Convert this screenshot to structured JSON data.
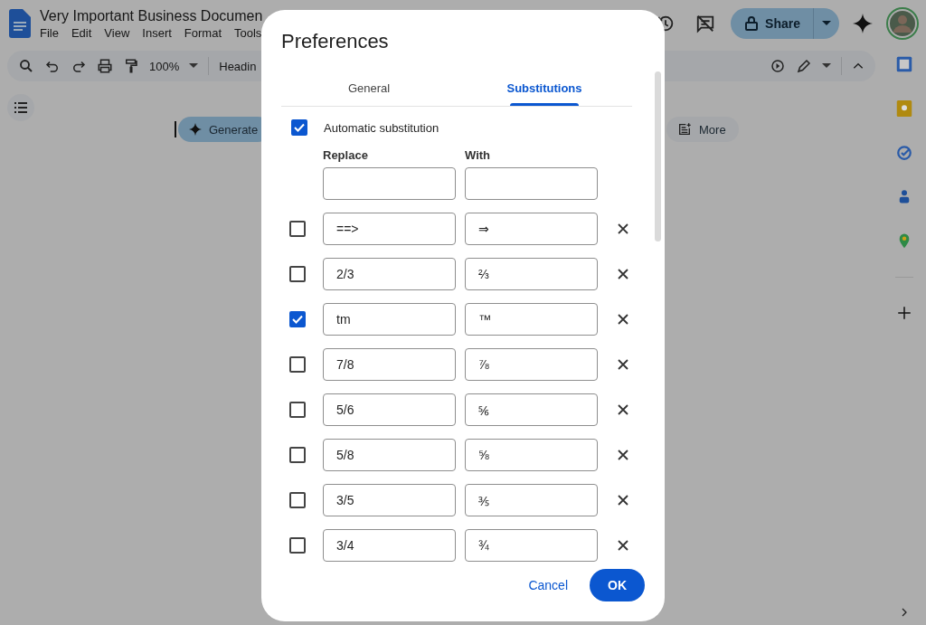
{
  "document": {
    "title": "Very Important Business Documen",
    "menu": [
      "File",
      "Edit",
      "View",
      "Insert",
      "Format",
      "Tools"
    ],
    "zoom": "100%",
    "style": "Headin",
    "share": "Share",
    "chips": [
      {
        "kind": "generate",
        "label": "Generate"
      },
      {
        "kind": "more",
        "label": "More"
      }
    ]
  },
  "dialog": {
    "title": "Preferences",
    "tabs": [
      {
        "label": "General",
        "selected": false
      },
      {
        "label": "Substitutions",
        "selected": true
      }
    ],
    "automatic": {
      "label": "Automatic substitution",
      "checked": true
    },
    "columns": [
      "Replace",
      "With"
    ],
    "rows": [
      {
        "replace": "==>",
        "with": "⇒",
        "checked": false
      },
      {
        "replace": "2/3",
        "with": "⅔",
        "checked": false
      },
      {
        "replace": "tm",
        "with": "™",
        "checked": true
      },
      {
        "replace": "7/8",
        "with": "⅞",
        "checked": false
      },
      {
        "replace": "5/6",
        "with": "⅚",
        "checked": false
      },
      {
        "replace": "5/8",
        "with": "⅝",
        "checked": false
      },
      {
        "replace": "3/5",
        "with": "⅗",
        "checked": false
      },
      {
        "replace": "3/4",
        "with": "¾",
        "checked": false
      }
    ],
    "cancel": "Cancel",
    "ok": "OK"
  }
}
